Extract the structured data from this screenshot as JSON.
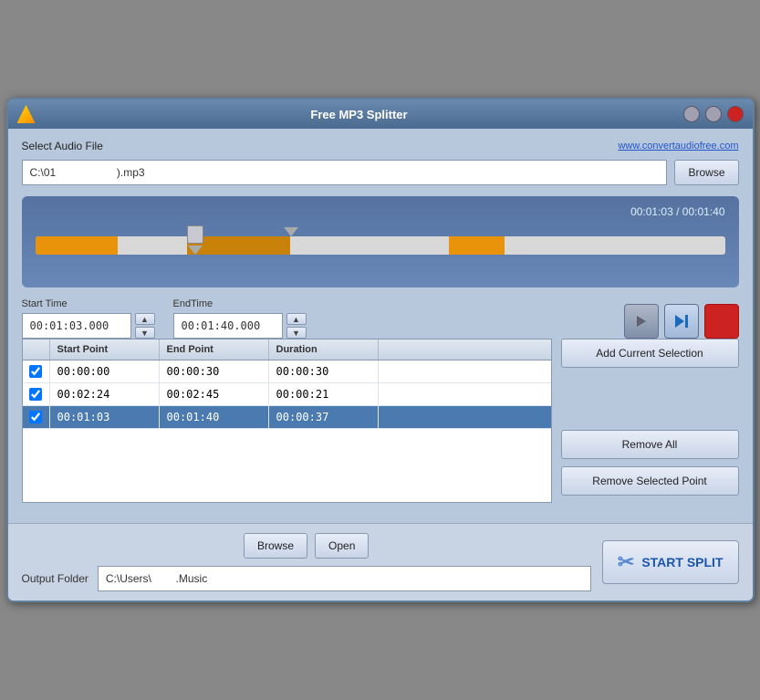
{
  "window": {
    "title": "Free MP3 Splitter"
  },
  "header": {
    "select_audio_label": "Select Audio File",
    "website_link": "www.convertaudiofree.com"
  },
  "file_input": {
    "value_prefix": "C:\\01",
    "value_suffix": ").mp3",
    "browse_label": "Browse"
  },
  "waveform": {
    "time_display": "00:01:03 / 00:01:40"
  },
  "time_controls": {
    "start_label": "Start Time",
    "start_value": "00:01:03.000",
    "end_label": "EndTime",
    "end_value": "00:01:40.000",
    "up_arrow": "▲",
    "down_arrow": "▼"
  },
  "table": {
    "headers": [
      "",
      "Start Point",
      "End Point",
      "Duration"
    ],
    "rows": [
      {
        "checked": true,
        "start": "00:00:00",
        "end": "00:00:30",
        "duration": "00:00:30",
        "selected": false
      },
      {
        "checked": true,
        "start": "00:02:24",
        "end": "00:02:45",
        "duration": "00:00:21",
        "selected": false
      },
      {
        "checked": true,
        "start": "00:01:03",
        "end": "00:01:40",
        "duration": "00:00:37",
        "selected": true
      }
    ]
  },
  "buttons": {
    "add_selection": "Add Current Selection",
    "remove_all": "Remove All",
    "remove_selected": "Remove Selected Point"
  },
  "bottom": {
    "output_label": "Output Folder",
    "output_value": "C:\\Users\\",
    "output_suffix": ".Music",
    "browse_label": "Browse",
    "open_label": "Open",
    "start_split_label": "START SPLIT"
  },
  "colors": {
    "accent_blue": "#1a55aa",
    "track_orange": "#e8930a",
    "selected_row_bg": "#4a7ab0"
  }
}
